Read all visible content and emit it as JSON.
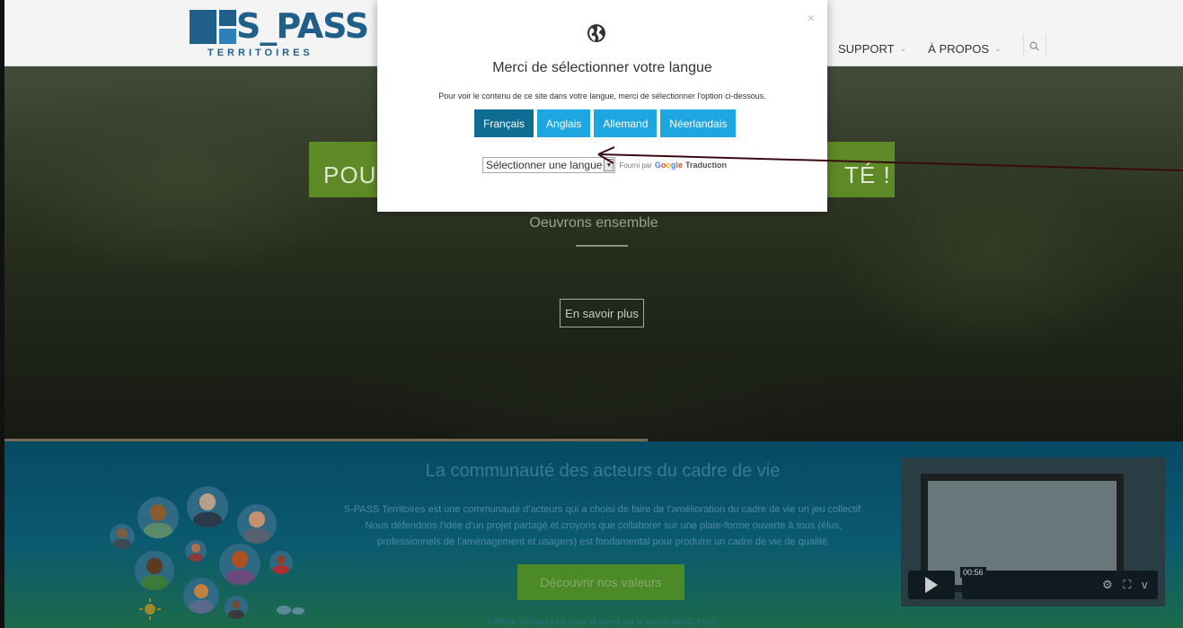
{
  "header": {
    "logo_text": "S_PASS",
    "logo_sub": "TERRITOIRES",
    "nav": [
      {
        "label": "SUPPORT"
      },
      {
        "label": "À PROPOS"
      }
    ]
  },
  "hero": {
    "title_left": "POU",
    "title_right": "TÉ !",
    "subtitle": "Oeuvrons ensemble",
    "button_label": "En savoir plus"
  },
  "community": {
    "title": "La communauté des acteurs du cadre de vie",
    "text": "S-PASS Territoires est une communauté d'acteurs qui a choisi de faire de l'amélioration du cadre de vie un jeu collectif. Nous défendons l'idée d'un projet partagé et croyons que collaborer sur une plate-forme ouverte à tous (élus, professionnels de l'aménagement et usagers) est fondamental pour produire un cadre de vie de qualité.",
    "button_label": "Découvrir nos valeurs",
    "footer": "S-PASS Territoires est porté et animé par le réseau des C.A.U.E.",
    "video_time": "00:56"
  },
  "modal": {
    "close": "×",
    "title": "Merci de sélectionner votre langue",
    "description": "Pour voir le contenu de ce site dans votre langue, merci de sélectionner l'option ci-dessous.",
    "languages": [
      {
        "label": "Français",
        "active": true
      },
      {
        "label": "Anglais",
        "active": false
      },
      {
        "label": "Allemand",
        "active": false
      },
      {
        "label": "Néerlandais",
        "active": false
      }
    ],
    "select_value": "Sélectionner une langue",
    "powered_by": "Fourni par",
    "google": "Google",
    "translate": "Traduction"
  },
  "colors": {
    "primary_blue": "#1ea6e0",
    "active_blue": "#0f6d93",
    "green": "#6aa028",
    "arrow": "#3a0a12"
  }
}
